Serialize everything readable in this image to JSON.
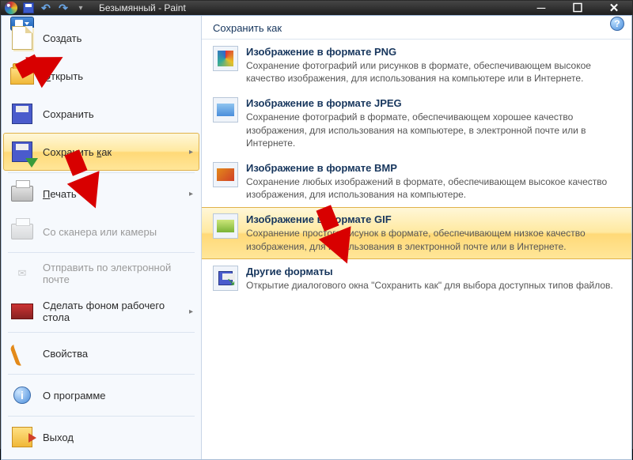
{
  "titlebar": {
    "document_name": "Безымянный",
    "app_name": "Paint",
    "separator": " - "
  },
  "ribbon": {
    "help_label": "?"
  },
  "sidebar": {
    "new_label": "Создать",
    "open_label_pre": "",
    "open_label_key": "О",
    "open_label_post": "ткрыть",
    "save_label": "Сохранить",
    "saveas_label_pre": "Сохранить ",
    "saveas_label_key": "к",
    "saveas_label_post": "ак",
    "print_label_pre": "",
    "print_label_key": "П",
    "print_label_post": "ечать",
    "scanner_label": "Со сканера или камеры",
    "email_label": "Отправить по электронной почте",
    "wallpaper_label": "Сделать фоном рабочего стола",
    "properties_label": "Свойства",
    "about_label": "О программе",
    "exit_label": "Выход"
  },
  "content": {
    "header": "Сохранить как",
    "formats": [
      {
        "title": "Изображение в формате PNG",
        "desc": "Сохранение фотографий или рисунков в формате, обеспечивающем высокое качество изображения, для использования на компьютере или в Интернете.",
        "icon": "png"
      },
      {
        "title": "Изображение в формате JPEG",
        "desc": "Сохранение фотографий в формате, обеспечивающем хорошее качество изображения, для использования на компьютере, в электронной почте или в Интернете.",
        "icon": "jpeg"
      },
      {
        "title": "Изображение в формате BMP",
        "desc": "Сохранение любых изображений в формате, обеспечивающем высокое качество изображения, для использования на компьютере.",
        "icon": "bmp"
      },
      {
        "title": "Изображение в формате GIF",
        "desc": "Сохранение простого рисунок в формате, обеспечивающем низкое качество изображения, для использования в электронной почте или в Интернете.",
        "icon": "gif",
        "active": true
      },
      {
        "title": "Другие форматы",
        "desc": "Открытие диалогового окна \"Сохранить как\" для выбора доступных типов файлов.",
        "icon": "other"
      }
    ]
  },
  "annotations": {
    "arrow1": {
      "target": "file-menu-button"
    },
    "arrow2": {
      "target": "sidebar-save-as"
    },
    "arrow3": {
      "target": "format-gif"
    }
  }
}
